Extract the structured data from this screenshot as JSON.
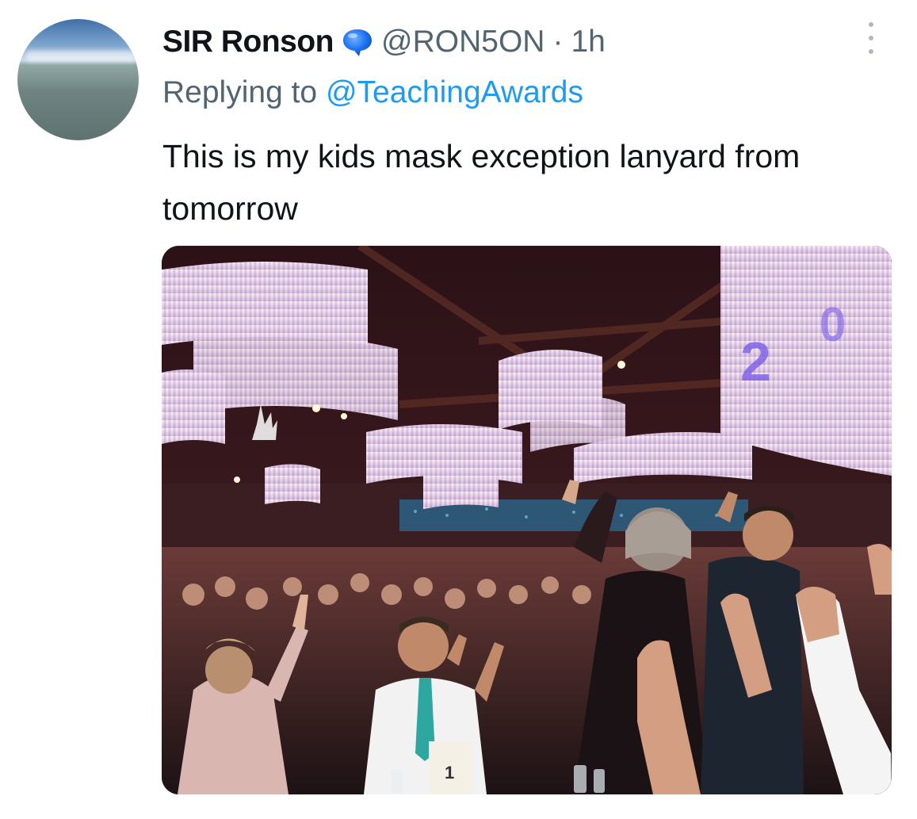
{
  "author": {
    "display_name": "SIR Ronson",
    "handle": "@RON5ON",
    "separator": "·",
    "time": "1h",
    "avatar_icon": "avatar-sky-sea",
    "verified_icon": "speech-bubble-icon"
  },
  "reply": {
    "prefix": "Replying to",
    "to_handle": "@TeachingAwards"
  },
  "tweet": {
    "text": "This is my kids mask exception lanyard from tomorrow"
  },
  "media": {
    "table_number": "1"
  },
  "colors": {
    "link": "#1d9bf0",
    "secondary_text": "#536471",
    "primary_text": "#0f1419",
    "verified_bubble": "#1d6ff0"
  }
}
